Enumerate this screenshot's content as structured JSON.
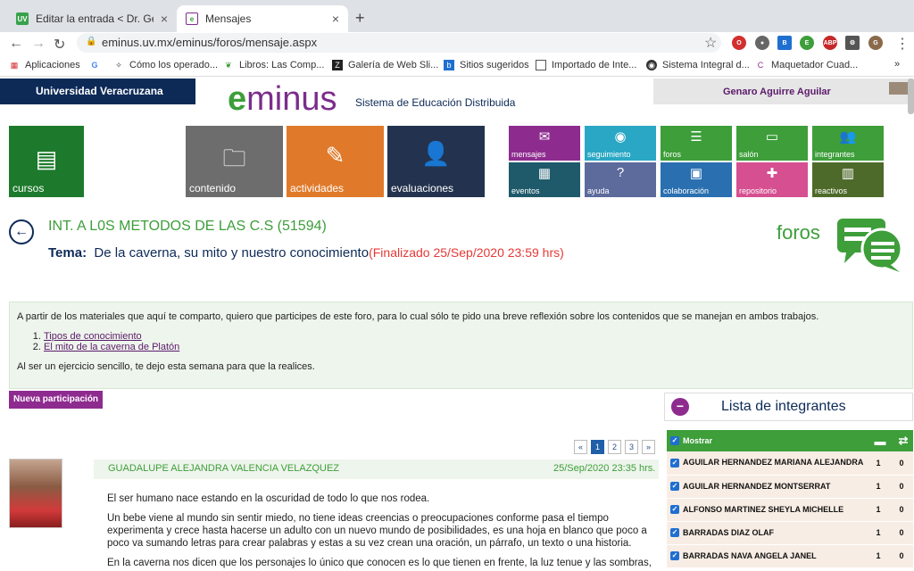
{
  "browser": {
    "tabs": [
      {
        "label": "Editar la entrada < Dr. Genaro",
        "icon": "uv-favicon",
        "color": "#3aa14b"
      },
      {
        "label": "Mensajes",
        "icon": "eminus-favicon",
        "color": "#7b2d8b"
      }
    ],
    "url": "eminus.uv.mx/eminus/foros/mensaje.aspx",
    "bookmarks": [
      "Aplicaciones",
      "Cómo los operado...",
      "Libros: Las Comp...",
      "Galería de Web Sli...",
      "Sitios sugeridos",
      "Importado de Inte...",
      "Sistema Integral d...",
      "Maquetador Cuad..."
    ]
  },
  "site": {
    "university": "Universidad Veracruzana",
    "logo_text": "minus",
    "logo_letter": "e",
    "tagline": "Sistema de Educación Distribuida",
    "user": "Genaro Aguirre Aguilar"
  },
  "tiles": {
    "big": [
      {
        "label": "cursos",
        "color": "#1d7a2c",
        "icon": "courses-icon"
      },
      {
        "label": "contenido",
        "color": "#6d6d6d",
        "icon": "content-icon"
      },
      {
        "label": "actividades",
        "color": "#e07a2a",
        "icon": "activities-icon"
      },
      {
        "label": "evaluaciones",
        "color": "#23334f",
        "icon": "evaluations-icon"
      }
    ],
    "small": [
      {
        "label": "mensajes",
        "color": "#8e2b8f",
        "icon": "mail-icon"
      },
      {
        "label": "seguimiento",
        "color": "#2aa7c4",
        "icon": "tracking-icon"
      },
      {
        "label": "foros",
        "color": "#3d9e3a",
        "icon": "forum-icon"
      },
      {
        "label": "salón",
        "color": "#3d9e3a",
        "icon": "classroom-icon"
      },
      {
        "label": "integrantes",
        "color": "#3d9e3a",
        "icon": "members-icon"
      },
      {
        "label": "eventos",
        "color": "#1e5a6a",
        "icon": "calendar-icon"
      },
      {
        "label": "ayuda",
        "color": "#5c6a9c",
        "icon": "help-icon"
      },
      {
        "label": "colaboración",
        "color": "#2a6fb0",
        "icon": "collaboration-icon"
      },
      {
        "label": "repositorio",
        "color": "#d64f90",
        "icon": "repository-icon"
      },
      {
        "label": "reactivos",
        "color": "#4e6a2a",
        "icon": "items-icon"
      }
    ]
  },
  "course": {
    "name": "INT. A L0S METODOS DE LAS C.S (51594)",
    "tema_label": "Tema:",
    "tema_title": "De la caverna, su mito y nuestro conocimiento",
    "status": "(Finalizado 25/Sep/2020 23:59 hrs)",
    "section": "foros"
  },
  "instructions": {
    "intro": "A partir de los materiales que aquí te comparto, quiero que participes de este foro, para lo cual sólo te pido una breve reflexión sobre los contenidos que se manejan en ambos trabajos.",
    "links": [
      "Tipos de conocimiento",
      "El mito de la  caverna de Platón"
    ],
    "outro": "Al ser un ejercicio sencillo, te dejo esta semana para que la realices."
  },
  "new_post_button": "Nueva participación",
  "pager": {
    "prev": "«",
    "pages": [
      "1",
      "2",
      "3"
    ],
    "next": "»",
    "current": "1"
  },
  "post": {
    "author": "GUADALUPE ALEJANDRA VALENCIA VELAZQUEZ",
    "date": "25/Sep/2020 23:35 hrs.",
    "paragraphs": [
      "El ser humano nace estando en la oscuridad de todo lo que nos rodea.",
      "Un bebe viene al mundo sin sentir miedo, no tiene ideas creencias o preocupaciones conforme pasa el tiempo experimenta y crece hasta hacerse un adulto con un nuevo mundo de posibilidades, es una hoja en blanco que poco a poco va sumando letras para crear palabras y estas a su vez crean una oración, un párrafo, un texto o una historia.",
      "En la caverna nos dicen que los personajes lo único que conocen es lo que tienen en frente, la luz tenue y las sombras, su"
    ]
  },
  "members": {
    "title": "Lista de integrantes",
    "show_label": "Mostrar",
    "rows": [
      {
        "name": "AGUILAR HERNANDEZ MARIANA ALEJANDRA",
        "posts": "1",
        "replies": "0"
      },
      {
        "name": "AGUILAR HERNANDEZ MONTSERRAT",
        "posts": "1",
        "replies": "0"
      },
      {
        "name": "ALFONSO MARTINEZ SHEYLA MICHELLE",
        "posts": "1",
        "replies": "0"
      },
      {
        "name": "BARRADAS DIAZ OLAF",
        "posts": "1",
        "replies": "0"
      },
      {
        "name": "BARRADAS NAVA ANGELA JANEL",
        "posts": "1",
        "replies": "0"
      }
    ]
  }
}
